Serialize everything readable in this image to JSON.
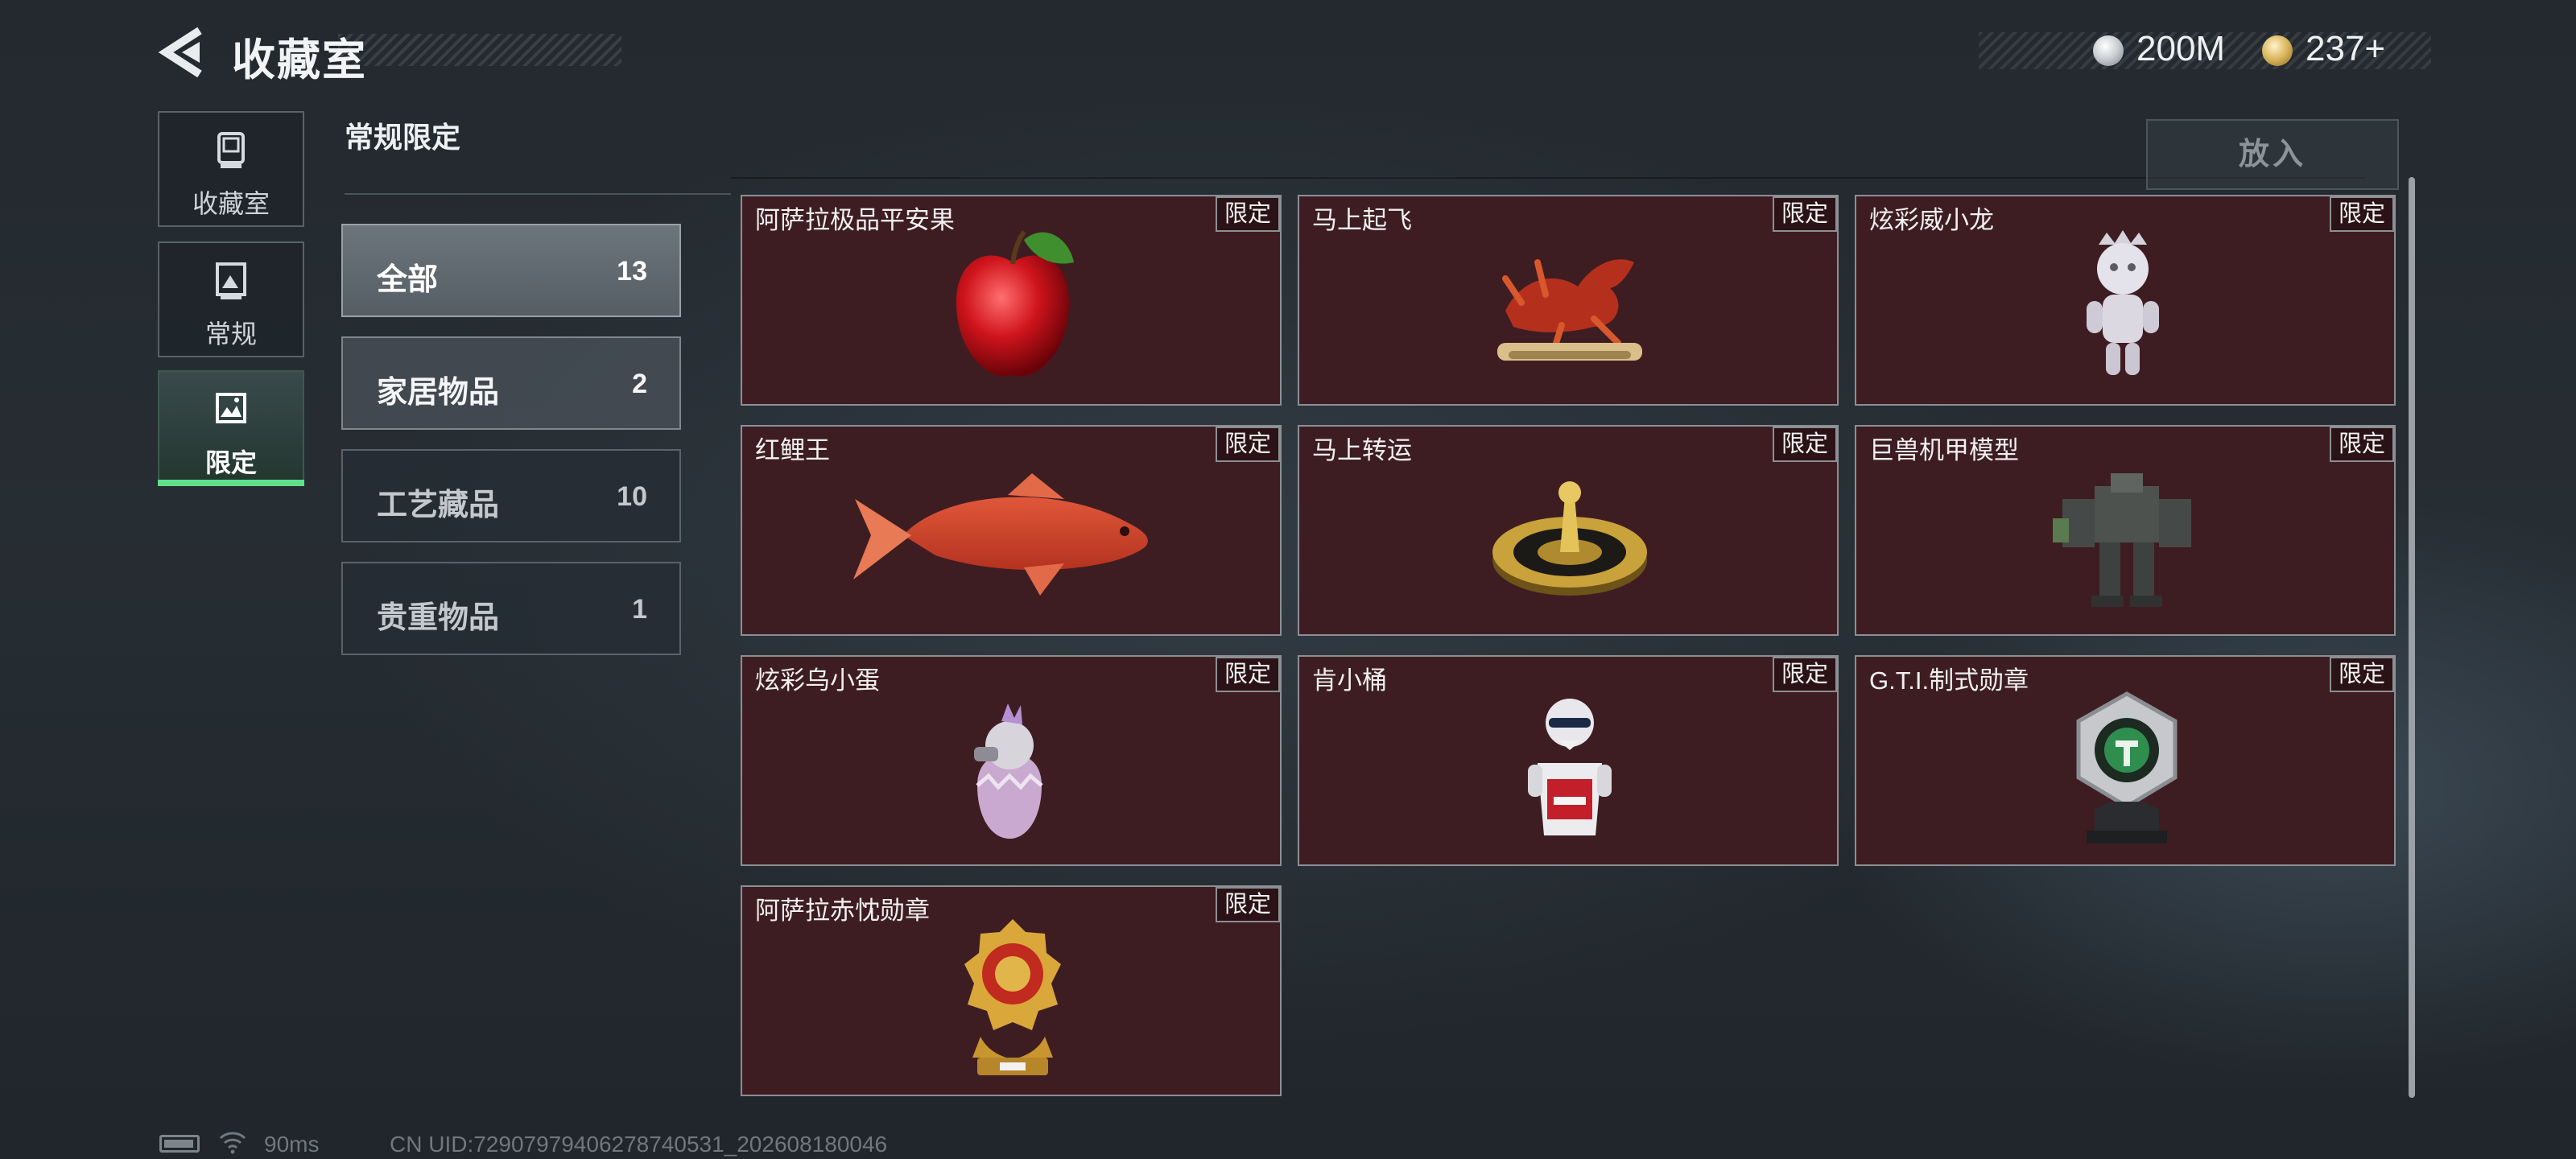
{
  "header": {
    "title": "收藏室",
    "currencies": [
      {
        "icon": "silver-coin-icon",
        "value": "200M"
      },
      {
        "icon": "gold-coin-icon",
        "value": "237+"
      }
    ]
  },
  "nav": {
    "items": [
      {
        "label": "收藏室",
        "icon": "trophy-icon",
        "active": false
      },
      {
        "label": "常规",
        "icon": "photo-frame-icon",
        "active": false
      },
      {
        "label": "限定",
        "icon": "landscape-icon",
        "active": true
      }
    ]
  },
  "section": {
    "title": "常规限定"
  },
  "filters": [
    {
      "label": "全部",
      "count": "13",
      "selected": true
    },
    {
      "label": "家居物品",
      "count": "2",
      "selected": false
    },
    {
      "label": "工艺藏品",
      "count": "10",
      "selected": false
    },
    {
      "label": "贵重物品",
      "count": "1",
      "selected": false
    }
  ],
  "actions": {
    "put_in_label": "放入"
  },
  "items": [
    {
      "name": "阿萨拉极品平安果",
      "tag": "限定",
      "icon": "red-apple-icon"
    },
    {
      "name": "马上起飞",
      "tag": "限定",
      "icon": "flying-horse-statue-icon"
    },
    {
      "name": "炫彩威小龙",
      "tag": "限定",
      "icon": "silver-figurine-icon"
    },
    {
      "name": "红鲤王",
      "tag": "限定",
      "icon": "red-carp-icon"
    },
    {
      "name": "马上转运",
      "tag": "限定",
      "icon": "golden-spinner-icon"
    },
    {
      "name": "巨兽机甲模型",
      "tag": "限定",
      "icon": "mech-model-icon"
    },
    {
      "name": "炫彩乌小蛋",
      "tag": "限定",
      "icon": "egg-figurine-icon"
    },
    {
      "name": "肯小桶",
      "tag": "限定",
      "icon": "kfc-bucket-figure-icon"
    },
    {
      "name": "G.T.I.制式勋章",
      "tag": "限定",
      "icon": "gti-medal-icon"
    },
    {
      "name": "阿萨拉赤忱勋章",
      "tag": "限定",
      "icon": "gold-medal-icon"
    }
  ],
  "status": {
    "ping": "90ms",
    "uid": "CN UID:72907979406278740531_202608180046"
  }
}
